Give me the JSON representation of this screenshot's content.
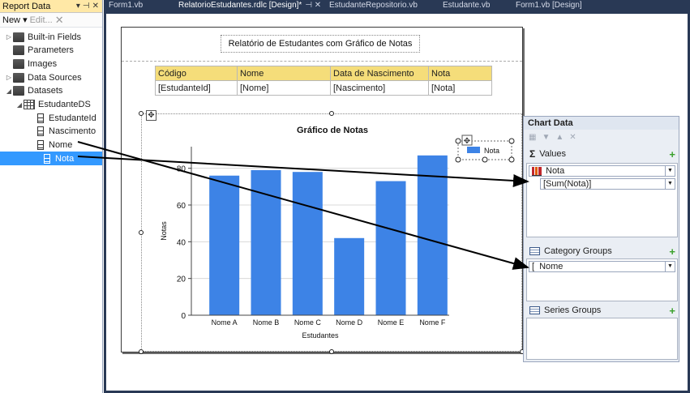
{
  "report_pane": {
    "title": "Report Data",
    "toolbar": {
      "new_label": "New",
      "edit_label": "Edit..."
    },
    "tree": [
      {
        "label": "Built-in Fields",
        "kind": "folder",
        "expander": "▷"
      },
      {
        "label": "Parameters",
        "kind": "folder",
        "expander": ""
      },
      {
        "label": "Images",
        "kind": "folder",
        "expander": ""
      },
      {
        "label": "Data Sources",
        "kind": "folder",
        "expander": "▷"
      },
      {
        "label": "Datasets",
        "kind": "folder",
        "expander": "◢"
      },
      {
        "label": "EstudanteDS",
        "kind": "dataset",
        "expander": "◢"
      },
      {
        "label": "EstudanteId",
        "kind": "field",
        "expander": ""
      },
      {
        "label": "Nascimento",
        "kind": "field",
        "expander": ""
      },
      {
        "label": "Nome",
        "kind": "field",
        "expander": ""
      },
      {
        "label": "Nota",
        "kind": "field",
        "expander": "",
        "selected": true
      }
    ]
  },
  "tabs": [
    {
      "label": "Form1.vb",
      "active": false,
      "ctrl": ""
    },
    {
      "label": "RelatorioEstudantes.rdlc [Design]*",
      "active": true,
      "ctrl": "⊣ ✕"
    },
    {
      "label": "EstudanteRepositorio.vb",
      "active": false,
      "ctrl": ""
    },
    {
      "label": "Estudante.vb",
      "active": false,
      "ctrl": ""
    },
    {
      "label": "Form1.vb [Design]",
      "active": false,
      "ctrl": ""
    }
  ],
  "report": {
    "title": "Relatório de Estudantes com Gráfico de Notas",
    "table": {
      "headers": [
        "Código",
        "Nome",
        "Data de Nascimento",
        "Nota"
      ],
      "row": [
        "[EstudanteId]",
        "[Nome]",
        "[Nascimento]",
        "[Nota]"
      ]
    }
  },
  "chart_data": {
    "type": "bar",
    "title": "Gráfico de Notas",
    "xlabel": "Estudantes",
    "ylabel": "Notas",
    "categories": [
      "Nome A",
      "Nome B",
      "Nome C",
      "Nome D",
      "Nome E",
      "Nome F"
    ],
    "series": [
      {
        "name": "Nota",
        "values": [
          76,
          79,
          78,
          42,
          73,
          87
        ]
      }
    ],
    "ylim": [
      0,
      90
    ],
    "yticks": [
      0,
      20,
      40,
      60,
      80
    ],
    "grid": true,
    "legend": "top-right",
    "bar_color": "#3d83e6"
  },
  "chart_panel": {
    "title": "Chart Data",
    "values_label": "Values",
    "values_field": "Nota",
    "values_expr": "[Sum(Nota)]",
    "category_label": "Category Groups",
    "category_field": "Nome",
    "series_label": "Series Groups"
  }
}
